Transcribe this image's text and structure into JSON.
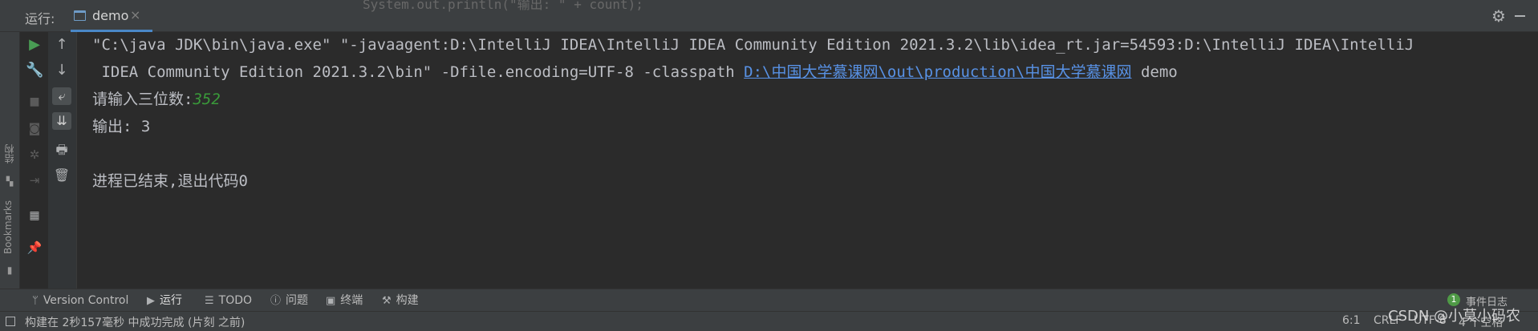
{
  "header": {
    "run_label": "运行:",
    "tab_label": "demo",
    "tab_close": "×",
    "background_code": "System.out.println(\"输出: \" + count);"
  },
  "side_labels": {
    "structure": "结构",
    "bookmarks": "Bookmarks"
  },
  "console": {
    "line1": "\"C:\\java JDK\\bin\\java.exe\" \"-javaagent:D:\\IntelliJ IDEA\\IntelliJ IDEA Community Edition 2021.3.2\\lib\\idea_rt.jar=54593:D:\\IntelliJ IDEA\\IntelliJ",
    "line2_prefix": " IDEA Community Edition 2021.3.2\\bin\" -Dfile.encoding=UTF-8 -classpath ",
    "line2_link": "D:\\中国大学慕课网\\out\\production\\中国大学慕课网",
    "line2_suffix": " demo",
    "prompt": "请输入三位数:",
    "input_value": "352",
    "output": "输出: 3",
    "exit": "进程已结束,退出代码0"
  },
  "toolwindows": {
    "version_control": "Version Control",
    "run": "运行",
    "todo": "TODO",
    "problems": "问题",
    "terminal": "终端",
    "build": "构建"
  },
  "events": {
    "count": "1",
    "label": "事件日志"
  },
  "status": {
    "message": "构建在 2秒157毫秒 中成功完成 (片刻 之前)",
    "position": "6:1",
    "line_sep": "CRLF",
    "encoding": "UTF-8",
    "indent": "4 个空格"
  },
  "watermark": "CSDN @小莫小码农",
  "colors": {
    "background": "#2b2b2b",
    "panel": "#3c3f41",
    "link": "#5892e6",
    "input": "#3a9a3a",
    "run_green": "#499c54"
  }
}
